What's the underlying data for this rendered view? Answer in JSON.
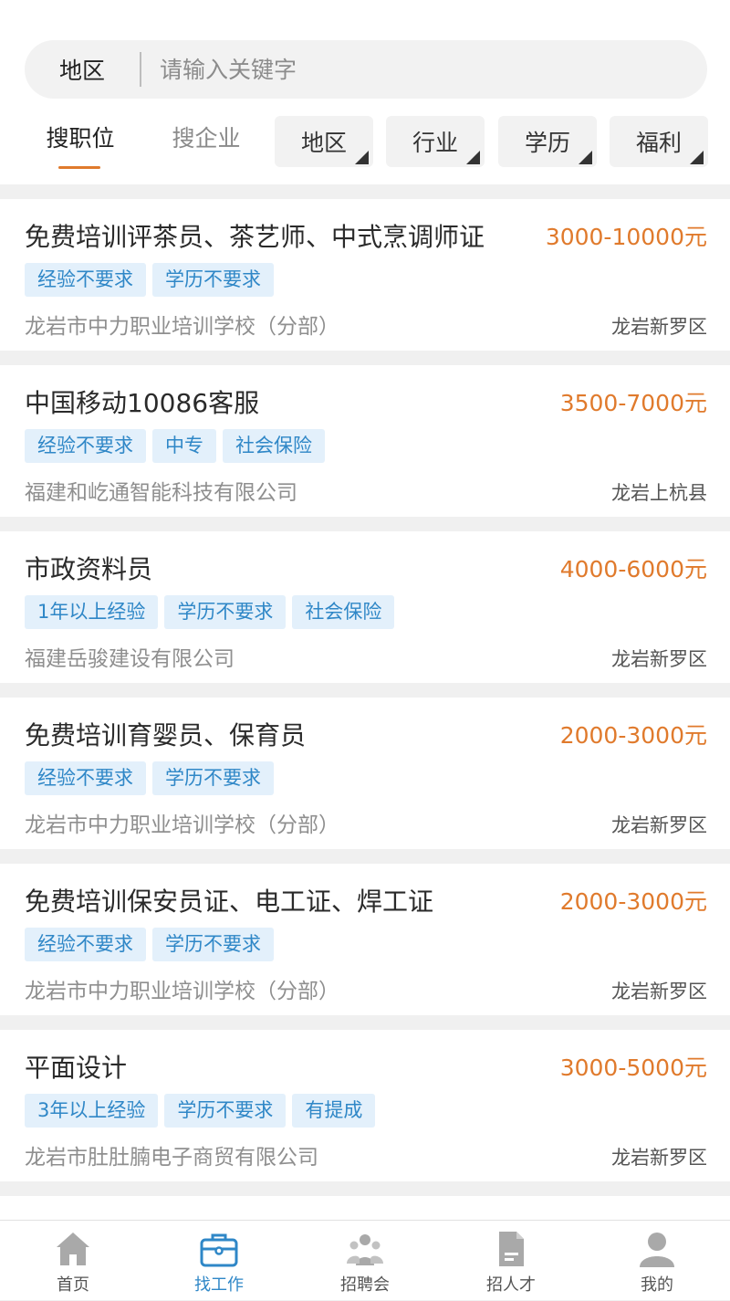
{
  "search": {
    "region_label": "地区",
    "placeholder": "请输入关键字"
  },
  "tabs": {
    "jobs": "搜职位",
    "companies": "搜企业"
  },
  "filters": [
    "地区",
    "行业",
    "学历",
    "福利"
  ],
  "jobs": [
    {
      "title": "免费培训评茶员、茶艺师、中式烹调师证",
      "salary": "3000-10000元",
      "tags": [
        "经验不要求",
        "学历不要求"
      ],
      "company": "龙岩市中力职业培训学校（分部）",
      "location": "龙岩新罗区"
    },
    {
      "title": "中国移动10086客服",
      "salary": "3500-7000元",
      "tags": [
        "经验不要求",
        "中专",
        "社会保险"
      ],
      "company": "福建和屹通智能科技有限公司",
      "location": "龙岩上杭县"
    },
    {
      "title": "市政资料员",
      "salary": "4000-6000元",
      "tags": [
        "1年以上经验",
        "学历不要求",
        "社会保险"
      ],
      "company": "福建岳骏建设有限公司",
      "location": "龙岩新罗区"
    },
    {
      "title": "免费培训育婴员、保育员",
      "salary": "2000-3000元",
      "tags": [
        "经验不要求",
        "学历不要求"
      ],
      "company": "龙岩市中力职业培训学校（分部）",
      "location": "龙岩新罗区"
    },
    {
      "title": "免费培训保安员证、电工证、焊工证",
      "salary": "2000-3000元",
      "tags": [
        "经验不要求",
        "学历不要求"
      ],
      "company": "龙岩市中力职业培训学校（分部）",
      "location": "龙岩新罗区"
    },
    {
      "title": "平面设计",
      "salary": "3000-5000元",
      "tags": [
        "3年以上经验",
        "学历不要求",
        "有提成"
      ],
      "company": "龙岩市肚肚腩电子商贸有限公司",
      "location": "龙岩新罗区"
    }
  ],
  "tabbar": {
    "items": [
      {
        "label": "首页",
        "icon": "home-icon"
      },
      {
        "label": "找工作",
        "icon": "briefcase-icon"
      },
      {
        "label": "招聘会",
        "icon": "job-fair-icon"
      },
      {
        "label": "招人才",
        "icon": "document-icon"
      },
      {
        "label": "我的",
        "icon": "user-icon"
      }
    ]
  },
  "colors": {
    "accent_orange": "#e07a2c",
    "tag_blue": "#2f87c7",
    "tag_bg": "#e3f0fb",
    "active_tab": "#2f87c7"
  }
}
